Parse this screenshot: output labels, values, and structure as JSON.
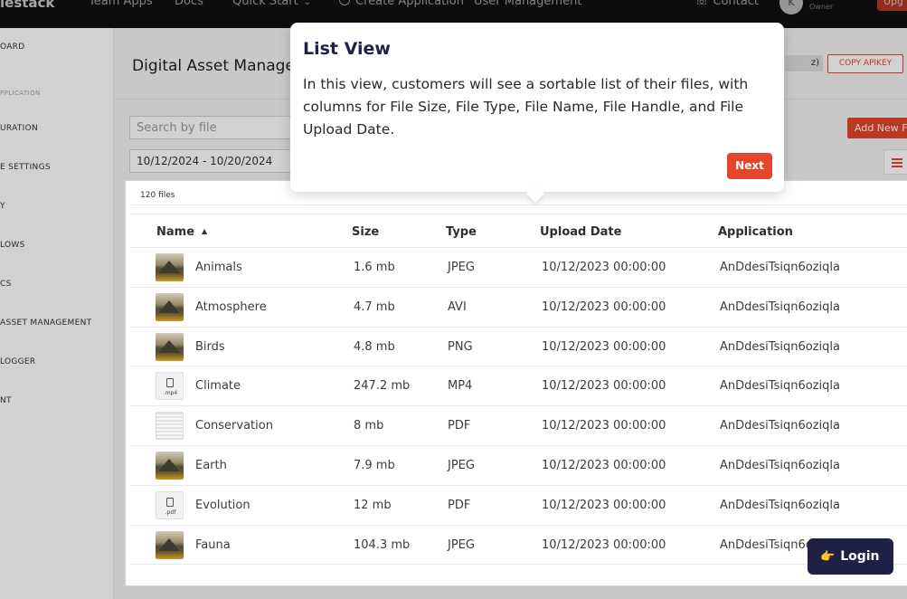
{
  "topbar": {
    "brand": "lestack",
    "nav": [
      "Team Apps",
      "Docs",
      "Quick Start",
      "Create Application",
      "User Management",
      "Contact"
    ],
    "avatar_initial": "K",
    "role": "Owner",
    "upgrade_label": "Upg"
  },
  "sidebar": {
    "items": [
      "OARD",
      "URATION",
      "E SETTINGS",
      "Y",
      "LOWS",
      "CS",
      "ASSET MANAGEMENT",
      "LOGGER",
      "NT"
    ],
    "section_label": "PPLICATION"
  },
  "main": {
    "title": "Digital Asset Manage",
    "apikey_fragment": "z)",
    "copy_apikey_label": "COPY APIKEY",
    "search_placeholder": "Search by file",
    "add_new_label": "Add New F",
    "date_range": "10/12/2024 - 10/20/2024",
    "files_count": "120 files"
  },
  "table": {
    "headers": [
      "Name",
      "Size",
      "Type",
      "Upload Date",
      "Application"
    ],
    "rows": [
      {
        "name": "Animals",
        "size": "1.6 mb",
        "type": "JPEG",
        "date": "10/12/2023 00:00:00",
        "app": "AnDdesiTsiqn6oziqla",
        "thumb": "img"
      },
      {
        "name": "Atmosphere",
        "size": "4.7 mb",
        "type": "AVI",
        "date": "10/12/2023 00:00:00",
        "app": "AnDdesiTsiqn6oziqla",
        "thumb": "img"
      },
      {
        "name": "Birds",
        "size": "4.8 mb",
        "type": "PNG",
        "date": "10/12/2023 00:00:00",
        "app": "AnDdesiTsiqn6oziqla",
        "thumb": "img"
      },
      {
        "name": "Climate",
        "size": "247.2 mb",
        "type": "MP4",
        "date": "10/12/2023 00:00:00",
        "app": "AnDdesiTsiqn6oziqla",
        "thumb": "file",
        "ext": ".mp4"
      },
      {
        "name": "Conservation",
        "size": "8 mb",
        "type": "PDF",
        "date": "10/12/2023 00:00:00",
        "app": "AnDdesiTsiqn6oziqla",
        "thumb": "doc"
      },
      {
        "name": "Earth",
        "size": "7.9 mb",
        "type": "JPEG",
        "date": "10/12/2023 00:00:00",
        "app": "AnDdesiTsiqn6oziqla",
        "thumb": "img"
      },
      {
        "name": "Evolution",
        "size": "12 mb",
        "type": "PDF",
        "date": "10/12/2023 00:00:00",
        "app": "AnDdesiTsiqn6oziqla",
        "thumb": "file",
        "ext": ".pdf"
      },
      {
        "name": "Fauna",
        "size": "104.3 mb",
        "type": "JPEG",
        "date": "10/12/2023 00:00:00",
        "app": "AnDdesiTsiqn6oziqla",
        "thumb": "img"
      }
    ]
  },
  "popover": {
    "title": "List View",
    "body": "In this view, customers will see a sortable list of their files, with columns for File Size, File Type, File Name, File Handle, and File Upload Date.",
    "next_label": "Next"
  },
  "login_label": "Login",
  "colors": {
    "accent": "#e5452b",
    "navy": "#1f2046",
    "nav_bg": "#141414"
  }
}
